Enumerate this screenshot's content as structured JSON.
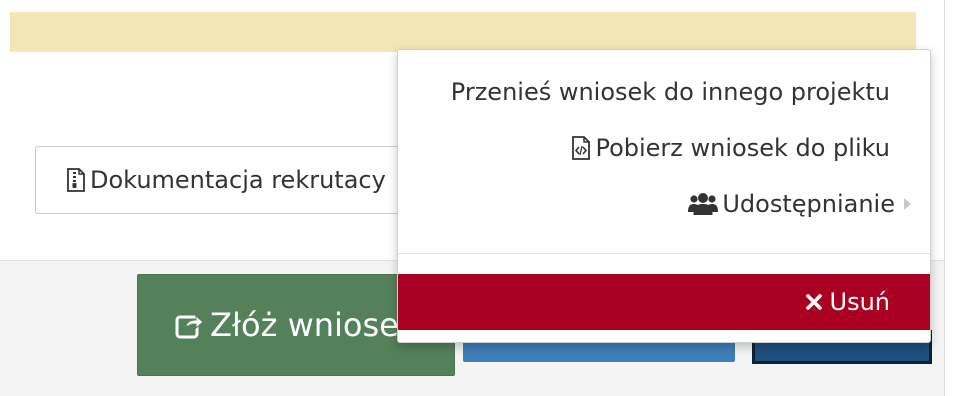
{
  "page": {
    "documentation_button_label": "Dokumentacja rekrutacy",
    "submit_button_label": "Złóż wniose"
  },
  "dropdown": {
    "items": [
      {
        "label": "Przenieś wniosek do innego projektu"
      },
      {
        "label": "Pobierz wniosek do pliku",
        "icon": "file-code-icon"
      },
      {
        "label": "Udostępnianie",
        "icon": "users-icon",
        "has_submenu": true
      }
    ],
    "delete_label": "Usuń",
    "delete_icon": "times-icon"
  },
  "colors": {
    "alert_bar": "#f2e5b6",
    "submit_green": "#54805a",
    "delete_red": "#aa0022",
    "blue_button": "#3d7fb8",
    "navy_button": "#1f4f7d"
  }
}
